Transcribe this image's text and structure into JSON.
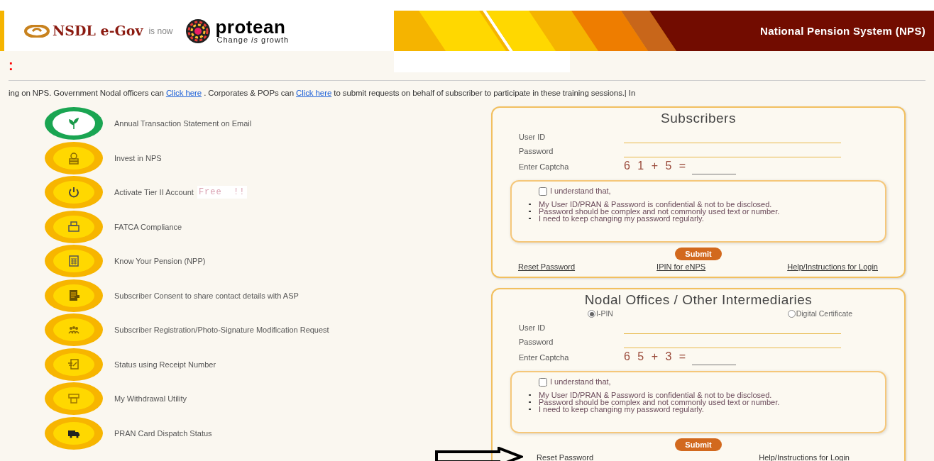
{
  "header": {
    "old_brand": "NSDL e-Gov",
    "is_now": "is now",
    "new_brand": "protean",
    "tagline": "Change *is* growth",
    "title": "National Pension System (NPS)"
  },
  "alert_mark": ":",
  "notice": [
    {
      "kind": "text",
      "text": "ing on NPS. Government Nodal officers can"
    },
    {
      "kind": "link",
      "text": "Click here"
    },
    {
      "kind": "text",
      "text": ". Corporates & POPs can"
    },
    {
      "kind": "link",
      "text": "Click here"
    },
    {
      "kind": "text",
      "text": "to submit requests on behalf of subscriber to participate in these training sessions.| In"
    }
  ],
  "services": [
    {
      "label": "Annual Transaction Statement on Email"
    },
    {
      "label": "Invest in NPS"
    },
    {
      "label": "Activate Tier II Account",
      "badge": "Free  !!"
    },
    {
      "label": "FATCA Compliance"
    },
    {
      "label": "Know Your Pension (NPP)"
    },
    {
      "label": "Subscriber Consent to share contact details with ASP"
    },
    {
      "label": "Subscriber Registration/Photo-Signature Modification Request"
    },
    {
      "label": "Status using Receipt Number"
    },
    {
      "label": "My Withdrawal Utility"
    },
    {
      "label": "PRAN Card Dispatch Status"
    }
  ],
  "panels": [
    {
      "title": "Subscribers",
      "fields": [
        {
          "label": "User ID"
        },
        {
          "label": "Password"
        }
      ],
      "captcha": {
        "label": "Enter Captcha",
        "text": "6 1 + 5 ="
      },
      "consent": {
        "checked": false,
        "label": "I understand that,",
        "points": [
          "My User ID/PRAN & Password is confidential & not to be disclosed.",
          "Password should be complex and not commonly used text or number.",
          "I need to keep changing my password regularly."
        ]
      },
      "submit": "Submit",
      "links": [
        "Reset Password",
        "IPIN for eNPS",
        "Help/Instructions for Login"
      ]
    },
    {
      "title": "Nodal Offices / Other Intermediaries",
      "radios": [
        {
          "label": "I-PIN",
          "selected": true
        },
        {
          "label": "Digital Certificate",
          "selected": false
        }
      ],
      "fields": [
        {
          "label": "User ID"
        },
        {
          "label": "Password"
        }
      ],
      "captcha": {
        "label": "Enter Captcha",
        "text": "6 5 + 3 ="
      },
      "consent": {
        "checked": false,
        "label": "I understand that,",
        "points": [
          "My User ID/PRAN & Password is confidential & not to be disclosed.",
          "Password should be complex and not commonly used text or number.",
          "I need to keep changing my password regularly."
        ]
      },
      "submit": "Submit",
      "links": [
        "Reset Password",
        "Help/Instructions for Login"
      ]
    }
  ]
}
